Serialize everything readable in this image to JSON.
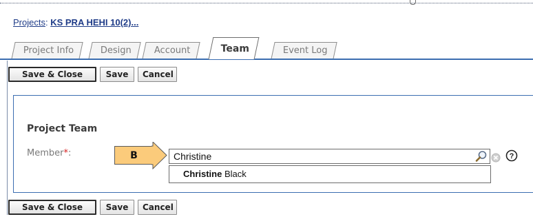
{
  "breadcrumb": {
    "root_label": "Projects",
    "separator": ":",
    "project_label": "KS PRA HEHI 10(2)..."
  },
  "tabs": [
    {
      "label": "Project Info",
      "active": false
    },
    {
      "label": "Design",
      "active": false
    },
    {
      "label": "Account",
      "active": false
    },
    {
      "label": "Team",
      "active": true
    },
    {
      "label": "Event Log",
      "active": false
    }
  ],
  "toolbar": {
    "save_close_label": "Save & Close",
    "save_label": "Save",
    "cancel_label": "Cancel"
  },
  "form": {
    "section_title": "Project Team",
    "member_label": "Member",
    "required_mark": "*",
    "label_suffix": ":",
    "member_value": "Christine",
    "suggestion": {
      "match": "Christine",
      "rest": " Black"
    }
  },
  "callout": {
    "letter": "B"
  },
  "icons": {
    "search": "search-icon",
    "clear": "clear-icon",
    "help": "help-icon"
  },
  "colors": {
    "link": "#1f3c88",
    "panel_border": "#3a6db0",
    "callout_fill": "#fbcb7b",
    "required": "#d62020"
  }
}
